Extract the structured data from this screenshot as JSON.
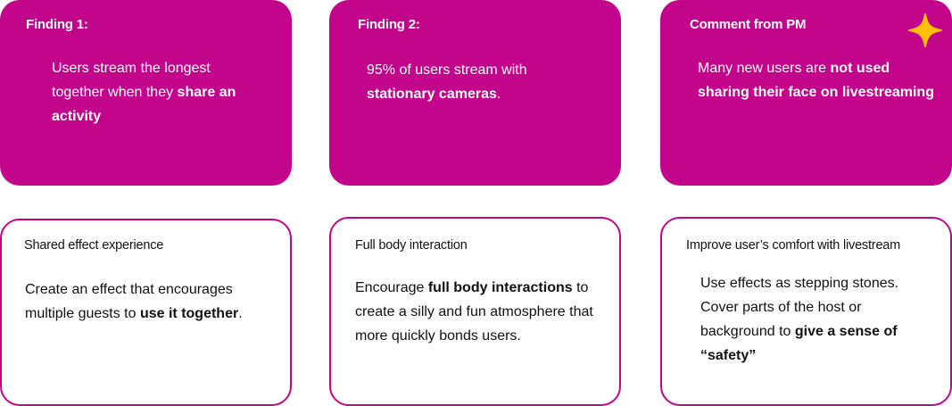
{
  "findings": [
    {
      "title": "Finding 1:",
      "body": [
        {
          "text": "Users stream the longest together when they ",
          "bold": false
        },
        {
          "text": "share an activity",
          "bold": true
        }
      ]
    },
    {
      "title": "Finding 2:",
      "body": [
        {
          "text": "95% of users stream with ",
          "bold": false
        },
        {
          "text": "stationary cameras",
          "bold": true
        },
        {
          "text": ".",
          "bold": false
        }
      ]
    },
    {
      "title": "Comment from PM",
      "body": [
        {
          "text": "Many new users are ",
          "bold": false
        },
        {
          "text": "not used sharing their face on livestreaming",
          "bold": true
        }
      ]
    }
  ],
  "ideas": [
    {
      "title": "Shared effect experience",
      "body": [
        {
          "text": "Create an effect that encourages multiple guests to ",
          "bold": false
        },
        {
          "text": "use it together",
          "bold": true
        },
        {
          "text": ".",
          "bold": false
        }
      ]
    },
    {
      "title": "Full body interaction",
      "body": [
        {
          "text": "Encourage ",
          "bold": false
        },
        {
          "text": "full body interactions",
          "bold": true
        },
        {
          "text": " to create a silly and fun atmosphere that more quickly bonds users.",
          "bold": false
        }
      ]
    },
    {
      "title": "Improve user’s comfort with livestream",
      "body": [
        {
          "text": "Use effects as stepping stones. Cover parts of the host or background to ",
          "bold": false
        },
        {
          "text": "give a sense of “safety”",
          "bold": true
        }
      ]
    }
  ],
  "icons": {
    "star": "sparkle-star-icon"
  },
  "colors": {
    "accent": "#c2058a",
    "star": "#ffc107"
  }
}
